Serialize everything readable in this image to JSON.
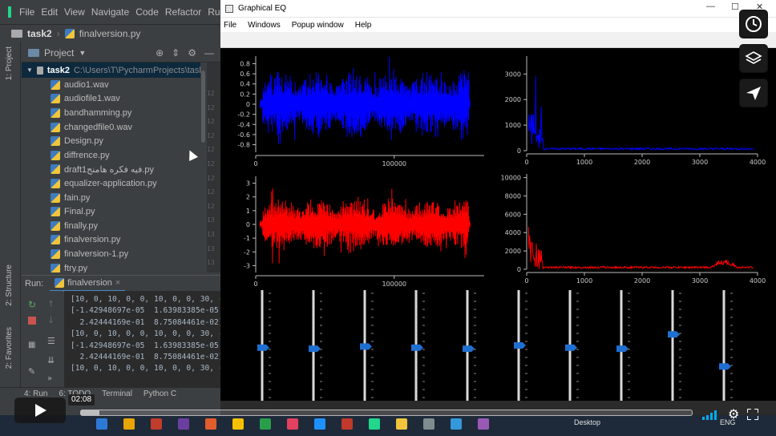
{
  "ide": {
    "menu": [
      "File",
      "Edit",
      "View",
      "Navigate",
      "Code",
      "Refactor",
      "Ru"
    ],
    "breadcrumb": {
      "project": "task2",
      "file": "finalversion.py"
    },
    "side_tabs": [
      "1: Project",
      "2: Structure",
      "2: Favorites"
    ],
    "project_panel": {
      "title": "Project",
      "root_name": "task2",
      "root_path": "C:\\Users\\T\\PycharmProjects\\task."
    },
    "files": [
      "audio1.wav",
      "audiofile1.wav",
      "bandhamming.py",
      "changedfile0.wav",
      "Design.py",
      "diffrence.py",
      "draft1فيه فكره هامنج.py",
      "equalizer-application.py",
      "fain.py",
      "Final.py",
      "finally.py",
      "finalversion.py",
      "finalversion-1.py",
      "ftry.py"
    ],
    "gutter": [
      "12",
      "12",
      "12",
      "12",
      "12",
      "12",
      "12",
      "12",
      "12",
      "13",
      "13",
      "13",
      "13"
    ],
    "run": {
      "label": "Run:",
      "tab": "finalversion"
    },
    "console_lines": [
      "[10, 0, 10, 0, 0, 10, 0, 0, 30, -30]",
      "[-1.42948697e-05  1.63983385e-05 -1.27",
      "  2.42444169e-01  8.75084461e-02]",
      "[10, 0, 10, 0, 0, 10, 0, 0, 30, -30]",
      "[-1.42948697e-05  1.63983385e-05 -1.27",
      "  2.42444169e-01  8.75084461e-02]",
      "[10, 0, 10, 0, 0, 10, 0, 0, 30, -30]"
    ],
    "bottom_tabs": [
      "4: Run",
      "6: TODO",
      "Terminal",
      "Python C"
    ]
  },
  "eq": {
    "title": "Graphical EQ",
    "menu": [
      "File",
      "Windows",
      "Popup window",
      "Help"
    ],
    "window_controls": [
      "—",
      "☐",
      "✕"
    ],
    "colors": {
      "top": "#0000ff",
      "bottom": "#ff0000",
      "slider_handle": "#1f6fd1"
    },
    "sliders": [
      0.48,
      0.47,
      0.49,
      0.48,
      0.47,
      0.5,
      0.48,
      0.47,
      0.6,
      0.31
    ]
  },
  "chart_data": [
    {
      "type": "line",
      "name": "time-signal-top",
      "xlim": [
        0,
        165000
      ],
      "ylim": [
        -0.95,
        0.95
      ],
      "x_ticks": [
        "0",
        "100000"
      ],
      "y_ticks": [
        "0.8",
        "0.6",
        "0.4",
        "0.2",
        "0",
        "-0.2",
        "-0.4",
        "-0.6",
        "-0.8"
      ],
      "color": "#0000ff"
    },
    {
      "type": "line",
      "name": "spectrum-top",
      "xlim": [
        0,
        4000
      ],
      "ylim": [
        0,
        3700
      ],
      "x_ticks": [
        "0",
        "1000",
        "2000",
        "3000",
        "4000"
      ],
      "y_ticks": [
        "3000",
        "2000",
        "1000",
        "0"
      ],
      "color": "#0000ff"
    },
    {
      "type": "line",
      "name": "time-signal-bottom",
      "xlim": [
        0,
        165000
      ],
      "ylim": [
        -3.5,
        3.5
      ],
      "x_ticks": [
        "0",
        "100000"
      ],
      "y_ticks": [
        "3",
        "2",
        "1",
        "0",
        "-1",
        "-2",
        "-3"
      ],
      "color": "#ff0000"
    },
    {
      "type": "line",
      "name": "spectrum-bottom",
      "xlim": [
        0,
        4000
      ],
      "ylim": [
        0,
        10400
      ],
      "x_ticks": [
        "0",
        "1000",
        "2000",
        "3000",
        "4000"
      ],
      "y_ticks": [
        "10000",
        "8000",
        "6000",
        "4000",
        "2000",
        "0"
      ],
      "color": "#ff0000"
    }
  ],
  "player": {
    "time": "02:08",
    "progress": 0.03
  },
  "taskbar": {
    "desktop": "Desktop",
    "lang": "ENG"
  }
}
